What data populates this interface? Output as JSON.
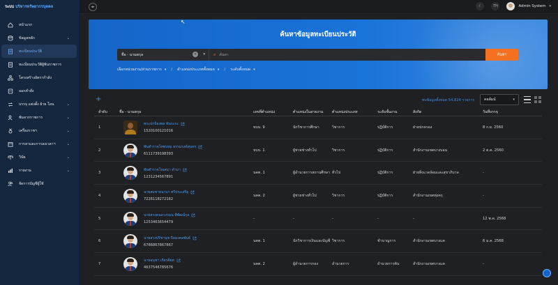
{
  "brand": {
    "prefix": "ระบบ",
    "name": "บริหารทรัพยากรบุคคล"
  },
  "sidebar": {
    "items": [
      {
        "label": "หน้าแรก",
        "icon": "home-icon",
        "chevron": false,
        "active": false
      },
      {
        "label": "ข้อมูลหลัก",
        "icon": "database-icon",
        "chevron": true,
        "active": false
      },
      {
        "label": "ทะเบียนประวัติ",
        "icon": "document-icon",
        "chevron": false,
        "active": true
      },
      {
        "label": "ทะเบียนประวัติผู้พ้นราชการ",
        "icon": "document-icon",
        "chevron": false,
        "active": false
      },
      {
        "label": "โครงสร้างอัตรากำลัง",
        "icon": "org-chart-icon",
        "chevron": false,
        "active": false
      },
      {
        "label": "ออกคำสั่ง",
        "icon": "order-icon",
        "chevron": false,
        "active": false
      },
      {
        "label": "บรรจุ แต่งตั้ง ย้าย โอน",
        "icon": "transfer-icon",
        "chevron": true,
        "active": false
      },
      {
        "label": "พ้นจากราชการ",
        "icon": "user-exit-icon",
        "chevron": true,
        "active": false
      },
      {
        "label": "เครื่องราชฯ",
        "icon": "medal-icon",
        "chevron": true,
        "active": false
      },
      {
        "label": "การลาและการลงเวลาฯ",
        "icon": "calendar-icon",
        "chevron": true,
        "active": false
      },
      {
        "label": "วินัย",
        "icon": "scale-icon",
        "chevron": true,
        "active": false
      },
      {
        "label": "รายงาน",
        "icon": "report-icon",
        "chevron": true,
        "active": false
      },
      {
        "label": "จัดการบัญชีผู้ใช้",
        "icon": "users-icon",
        "chevron": false,
        "active": false
      }
    ]
  },
  "topbar": {
    "language": "TH",
    "user_name": "Admin System"
  },
  "hero": {
    "title": "ค้นหาข้อมูลทะเบียนประวัติ",
    "search_field_value": "ชื่อ - นามสกุล",
    "search_placeholder": "ค้นหา",
    "search_button": "ค้นหา",
    "filters": [
      "เลือกหน่วยงาน/ส่วนราชการ",
      "ตำแหน่งประเภททั้งหมด",
      "ระดับทั้งหมด"
    ]
  },
  "toolbar": {
    "result_count": "พบข้อมูลทั้งหมด 54,824 รายการ",
    "sort_value": "คอลัมน์"
  },
  "table": {
    "headers": [
      "ลำดับ",
      "ชื่อ - นามสกุล",
      "เลขที่ตำแหน่ง",
      "ตำแหน่งในสายงาน",
      "ตำแหน่งประเภท",
      "ระดับชั้นงาน",
      "สังกัด",
      "วันที่บรรจุ"
    ],
    "rows": [
      {
        "no": "1",
        "name": "พระปกป้องพล ทันระกะ",
        "id": "1520100121016",
        "position_no": "ขบบ. 9",
        "line_position": "นักวิชาการศึกษา",
        "type": "วิชาการ",
        "level": "ปฏิบัติการ",
        "unit": "ฝ่ายปกครอง",
        "date": "8 ก.ย. 2560",
        "photo": true
      },
      {
        "no": "2",
        "name": "พันตำรวจโทพรหม ธรรมรงค์สุนทร",
        "id": "6111739198393",
        "position_no": "ขบบ. 1",
        "line_position": "ผู้ช่วยช่างทั่วไป",
        "type": "วิชาการ",
        "level": "ปฏิบัติการ",
        "unit": "สำนักงานเขตบางบอน",
        "date": "2 ต.ค. 2560",
        "photo": false
      },
      {
        "no": "3",
        "name": "พันตำรวจโทเสมา คำมา",
        "id": "1231234567891",
        "position_no": "นคต. 1",
        "line_position": "ผู้อำนวยการสถานศึกษา",
        "type": "ทั่วไป",
        "level": "ปฏิบัติการ",
        "unit": "ฝ่ายสิ่งแวดล้อมและสุขาภิบาล",
        "date": "-",
        "photo": false
      },
      {
        "no": "4",
        "name": "นายสมชายนาบา ศรีประเสริฐ",
        "id": "7226118272182",
        "position_no": "นคต. 2",
        "line_position": "ผู้ช่วยช่างทั่วไป",
        "type": "วิชาการ",
        "level": "ปฏิบัติการ",
        "unit": "สำนักงานเขตทุ่งครุ",
        "date": "-",
        "photo": false
      },
      {
        "no": "5",
        "name": "นายสวงคนลวงรมน พิพัฒน์กุล",
        "id": "1253463654479",
        "position_no": "-",
        "line_position": "-",
        "type": "-",
        "level": "-",
        "unit": "-",
        "date": "12 พ.ค. 2568",
        "photo": false
      },
      {
        "no": "6",
        "name": "นายสวงปรีชานุช ปิยมงคลพันธ์",
        "id": "6786867867867",
        "position_no": "นคต. 1",
        "line_position": "นักวิชาการเงินและบัญชี",
        "type": "วิชาการ",
        "level": "ชำนาญการ",
        "unit": "สำนักงานเขตบางแค",
        "date": "6 ม.ค. 2568",
        "photo": false
      },
      {
        "no": "7",
        "name": "นายอนุชา เกียรติยศ",
        "id": "4637546785676",
        "position_no": "นคต. 2",
        "line_position": "ผู้อำนวยการกอง",
        "type": "อำนวยการ",
        "level": "อำนวยการต้น",
        "unit": "สำนักงานเขตบางแค",
        "date": "-",
        "photo": false
      }
    ]
  },
  "colors": {
    "accent": "#f37120",
    "link": "#4a9ef0",
    "hero": "#1a73d8",
    "sidebar": "#15263f"
  }
}
